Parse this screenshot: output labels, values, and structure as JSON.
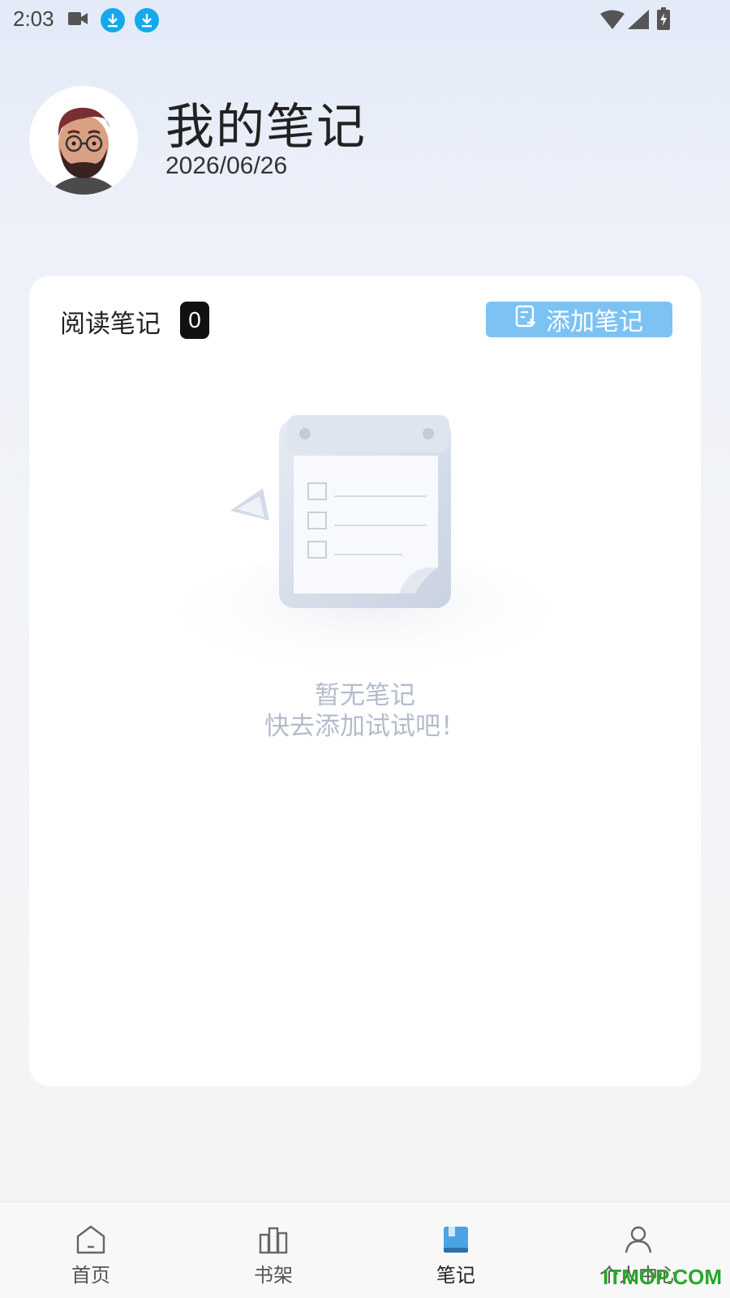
{
  "status_bar": {
    "time": "2:03"
  },
  "header": {
    "title": "我的笔记",
    "date": "2026/06/26"
  },
  "notes_card": {
    "section_title": "阅读笔记",
    "count": "0",
    "add_button_label": "添加笔记",
    "empty_line1": "暂无笔记",
    "empty_line2": "快去添加试试吧！"
  },
  "bottom_nav": {
    "items": [
      {
        "label": "首页",
        "icon": "home-icon"
      },
      {
        "label": "书架",
        "icon": "bookshelf-icon"
      },
      {
        "label": "笔记",
        "icon": "notes-icon",
        "active": true
      },
      {
        "label": "个人中心",
        "icon": "profile-icon"
      }
    ]
  },
  "watermark": "ITMOP.COM",
  "colors": {
    "accent": "#7cc3f4",
    "download_badge": "#14a8ec",
    "empty_text": "#b3bccc"
  }
}
